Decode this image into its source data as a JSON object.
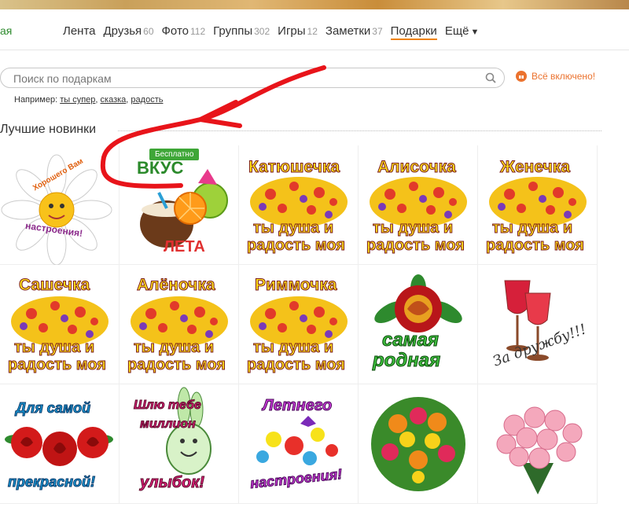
{
  "header": {
    "brand_fragment": "ая"
  },
  "nav": [
    {
      "label": "Лента",
      "count": ""
    },
    {
      "label": "Друзья",
      "count": "60"
    },
    {
      "label": "Фото",
      "count": "112"
    },
    {
      "label": "Группы",
      "count": "302"
    },
    {
      "label": "Игры",
      "count": "12"
    },
    {
      "label": "Заметки",
      "count": "37"
    },
    {
      "label": "Подарки",
      "count": "",
      "active": true
    },
    {
      "label": "Ещё",
      "count": ""
    }
  ],
  "search": {
    "placeholder": "Поиск по подаркам"
  },
  "all_included": "Всё включено!",
  "example": {
    "prefix": "Например:",
    "links": [
      "ты супер",
      "сказка",
      "радость"
    ]
  },
  "section_title": "Лучшие новинки",
  "free_badge": "Бесплатно",
  "gifts": [
    {
      "l1": "Хорошего Вам",
      "l2": "настроения!"
    },
    {
      "l1": "ВКУС",
      "l2": "ЛЕТА"
    },
    {
      "l1": "Катюшечка",
      "l2": "ты душа и",
      "l3": "радость моя"
    },
    {
      "l1": "Алисочка",
      "l2": "ты душа и",
      "l3": "радость моя"
    },
    {
      "l1": "Женечка",
      "l2": "ты душа и",
      "l3": "радость моя"
    },
    {
      "l1": "Сашечка",
      "l2": "ты душа и",
      "l3": "радость моя"
    },
    {
      "l1": "Алёночка",
      "l2": "ты душа и",
      "l3": "радость моя"
    },
    {
      "l1": "Риммочка",
      "l2": "ты душа и",
      "l3": "радость моя"
    },
    {
      "l1": "самая",
      "l2": "родная"
    },
    {
      "l1": "За дружбу!!!"
    },
    {
      "l1": "Для самой",
      "l2": "прекрасной!"
    },
    {
      "l1": "Шлю тебе",
      "l2": "миллион",
      "l3": "улыбок!"
    },
    {
      "l1": "Летнего",
      "l2": "настроения!"
    },
    {},
    {}
  ]
}
